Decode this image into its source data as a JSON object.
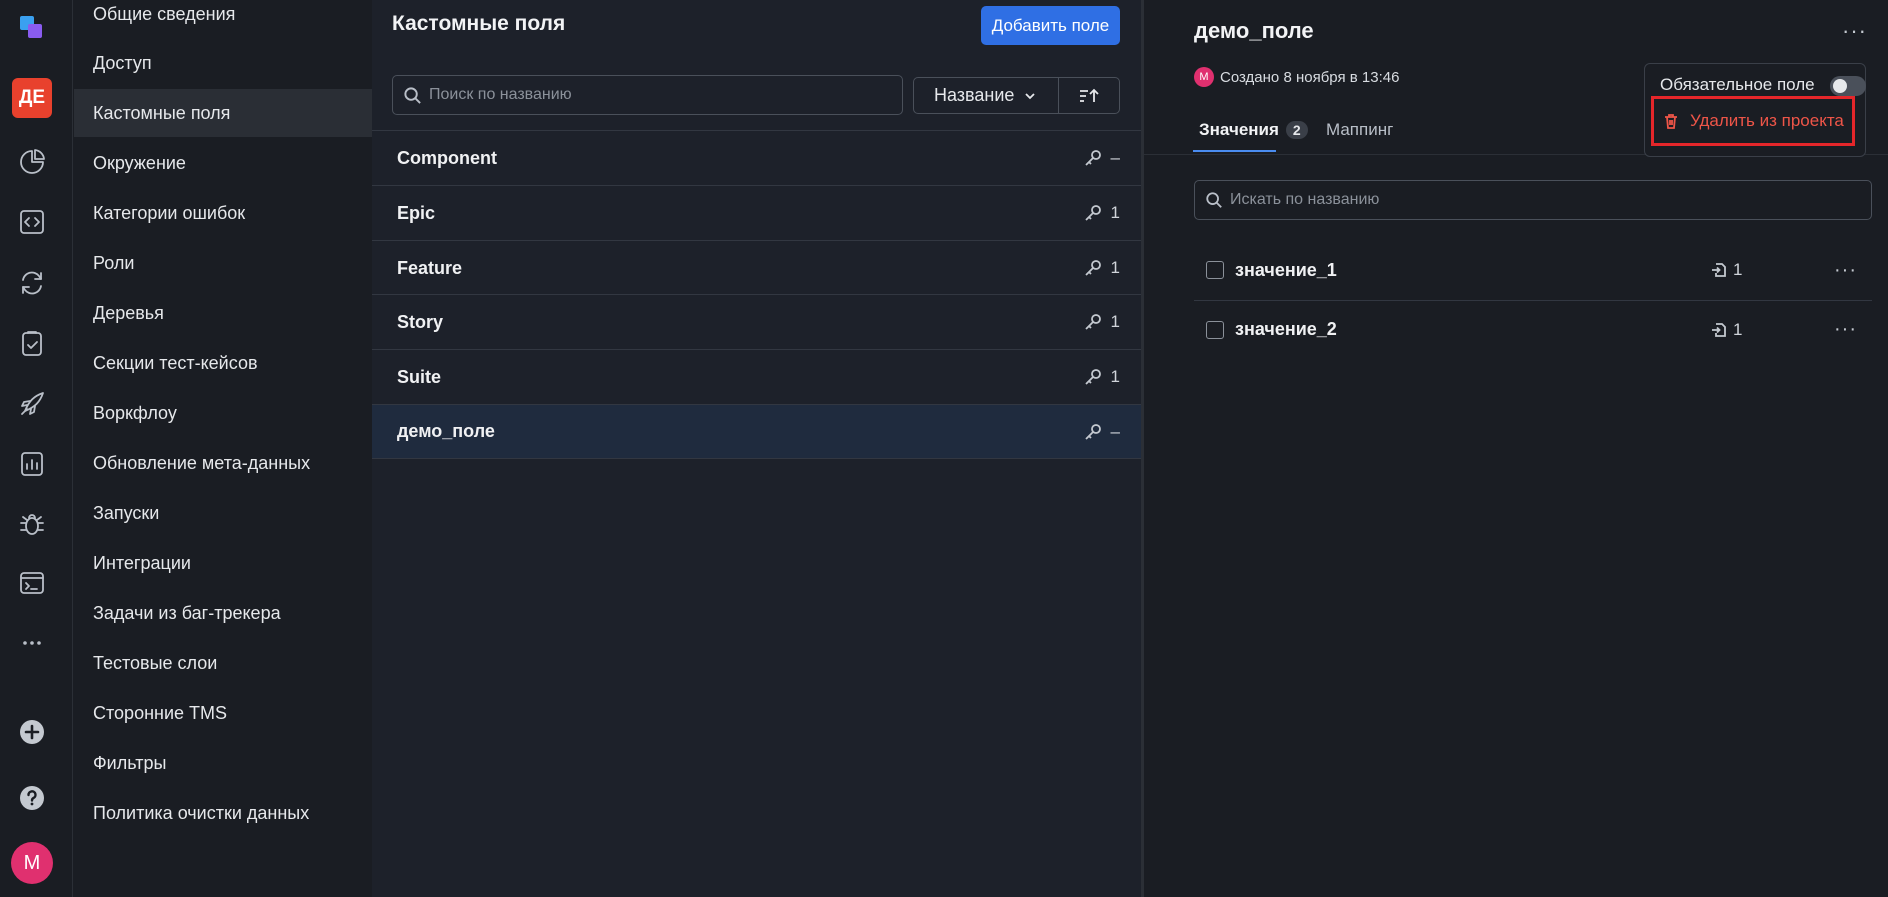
{
  "rail": {
    "project_badge": "ДЕ",
    "user_initial": "M",
    "icons": [
      "logo-icon",
      "dashboard-icon",
      "code-icon",
      "sync-icon",
      "testcases-icon",
      "launch-icon",
      "reports-icon",
      "bug-icon",
      "terminal-icon",
      "more-icon",
      "add-icon",
      "help-icon"
    ]
  },
  "settings_menu": {
    "items": [
      {
        "label": "Общие сведения"
      },
      {
        "label": "Доступ"
      },
      {
        "label": "Кастомные поля"
      },
      {
        "label": "Окружение"
      },
      {
        "label": "Категории ошибок"
      },
      {
        "label": "Роли"
      },
      {
        "label": "Деревья"
      },
      {
        "label": "Секции тест-кейсов"
      },
      {
        "label": "Воркфлоу"
      },
      {
        "label": "Обновление мета-данных"
      },
      {
        "label": "Запуски"
      },
      {
        "label": "Интеграции"
      },
      {
        "label": "Задачи из баг-трекера"
      },
      {
        "label": "Тестовые слои"
      },
      {
        "label": "Сторонние TMS"
      },
      {
        "label": "Фильтры"
      },
      {
        "label": "Политика очистки данных"
      }
    ]
  },
  "fields_list": {
    "title": "Кастомные поля",
    "add_button": "Добавить поле",
    "search_placeholder": "Поиск по названию",
    "sort_by": "Название",
    "rows": [
      {
        "name": "Component",
        "count": "–"
      },
      {
        "name": "Epic",
        "count": "1"
      },
      {
        "name": "Feature",
        "count": "1"
      },
      {
        "name": "Story",
        "count": "1"
      },
      {
        "name": "Suite",
        "count": "1"
      },
      {
        "name": "демо_поле",
        "count": "–"
      }
    ]
  },
  "detail": {
    "title": "демо_поле",
    "more": "···",
    "created_avatar": "M",
    "created_text": "Создано 8 ноября в 13:46",
    "tabs": [
      {
        "label": "Значения",
        "count": "2"
      },
      {
        "label": "Маппинг"
      }
    ],
    "search_placeholder": "Искать по названию",
    "values": [
      {
        "name": "значение_1",
        "usage": "1",
        "more": "···"
      },
      {
        "name": "значение_2",
        "usage": "1",
        "more": "···"
      }
    ]
  },
  "popup": {
    "required_label": "Обязательное поле",
    "required_on": false,
    "delete_label": "Удалить из проекта"
  },
  "colors": {
    "accent": "#2f6fe4",
    "danger": "#ee5548",
    "highlight_box": "#e5262a",
    "badge": "#e8412d",
    "avatar": "#e0306f"
  }
}
